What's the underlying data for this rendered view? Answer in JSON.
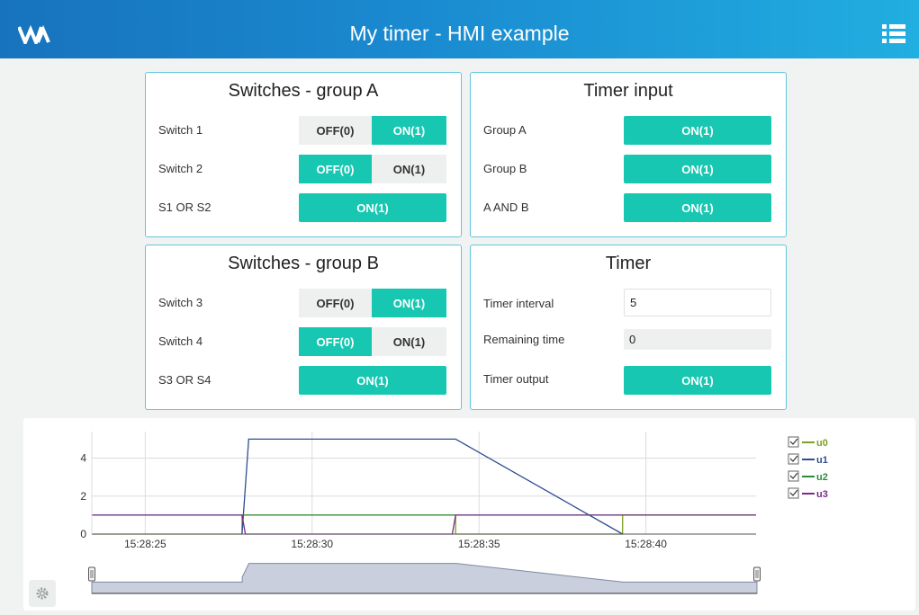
{
  "header": {
    "title": "My timer - HMI example",
    "logo_icon": "wago-logo-icon",
    "menu_icon": "list-menu-icon"
  },
  "panels": {
    "group_a": {
      "title": "Switches - group A",
      "rows": [
        {
          "label": "Switch 1",
          "off": "OFF(0)",
          "on": "ON(1)",
          "state": "on"
        },
        {
          "label": "Switch 2",
          "off": "OFF(0)",
          "on": "ON(1)",
          "state": "off"
        }
      ],
      "result": {
        "label": "S1 OR S2",
        "value": "ON(1)"
      }
    },
    "group_b": {
      "title": "Switches - group B",
      "rows": [
        {
          "label": "Switch 3",
          "off": "OFF(0)",
          "on": "ON(1)",
          "state": "on"
        },
        {
          "label": "Switch 4",
          "off": "OFF(0)",
          "on": "ON(1)",
          "state": "off"
        }
      ],
      "result": {
        "label": "S3 OR S4",
        "value": "ON(1)"
      }
    },
    "timer_input": {
      "title": "Timer input",
      "rows": [
        {
          "label": "Group A",
          "value": "ON(1)"
        },
        {
          "label": "Group B",
          "value": "ON(1)"
        },
        {
          "label": "A AND B",
          "value": "ON(1)"
        }
      ]
    },
    "timer": {
      "title": "Timer",
      "interval_label": "Timer interval",
      "interval_value": "5",
      "remaining_label": "Remaining time",
      "remaining_value": "0",
      "output_label": "Timer output",
      "output_value": "ON(1)"
    }
  },
  "colors": {
    "accent": "#17c7b1",
    "header_start": "#1773bd",
    "header_end": "#21aee0",
    "panel_border": "#60c6dc"
  },
  "chart_data": {
    "type": "line",
    "x_ticks": [
      "15:28:25",
      "15:28:30",
      "15:28:35",
      "15:28:40"
    ],
    "y_ticks": [
      "0",
      "2",
      "4"
    ],
    "ylim": [
      0,
      5.4
    ],
    "xlim": [
      "15:28:23.4",
      "15:28:43.3"
    ],
    "grid": true,
    "legend_position": "right",
    "series": [
      {
        "name": "u0",
        "color": "#7e9f22",
        "x": [
          "15:28:23.4",
          "15:28:27.9",
          "15:28:27.9",
          "15:28:34.3",
          "15:28:34.3",
          "15:28:39.3",
          "15:28:39.3",
          "15:28:43.3"
        ],
        "y": [
          0,
          0,
          1,
          1,
          0,
          0,
          1,
          1
        ]
      },
      {
        "name": "u1",
        "color": "#2e4f8f",
        "x": [
          "15:28:27.9",
          "15:28:28.1",
          "15:28:34.3",
          "15:28:39.3"
        ],
        "y": [
          0,
          5,
          5,
          0
        ]
      },
      {
        "name": "u2",
        "color": "#2f8a3a",
        "x": [
          "15:28:23.4",
          "15:28:43.3"
        ],
        "y": [
          1,
          1
        ]
      },
      {
        "name": "u3",
        "color": "#7a2a8c",
        "x": [
          "15:28:23.4",
          "15:28:27.9",
          "15:28:28.0",
          "15:28:34.2",
          "15:28:34.3",
          "15:28:43.3"
        ],
        "y": [
          1,
          1,
          0,
          0,
          1,
          1
        ]
      }
    ],
    "legend_checked": [
      true,
      true,
      true,
      true
    ],
    "navigator_series": "u1"
  }
}
